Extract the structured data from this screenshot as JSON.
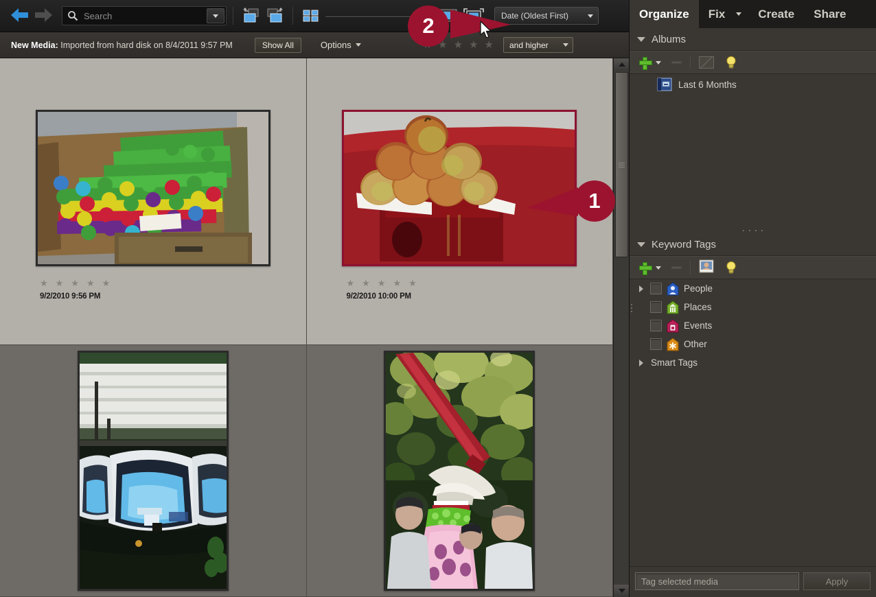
{
  "toolbar": {
    "back_icon": "back-arrow-icon",
    "forward_icon": "forward-arrow-icon",
    "search_placeholder": "Search",
    "search_value": "",
    "rotate_left_label": "Rotate Left",
    "rotate_right_label": "Rotate Right",
    "grid_view_label": "Grid View",
    "slideshow_label": "Slideshow",
    "fullscreen_label": "Full Screen",
    "sort_value": "Date (Oldest First)"
  },
  "subbar": {
    "new_media_label": "New Media:",
    "new_media_text": "Imported from hard disk on 8/4/2011 9:57 PM",
    "show_all_label": "Show All",
    "options_label": "Options",
    "rating_filter_stars": 5,
    "rating_filter_value": "and higher"
  },
  "grid": {
    "photos": [
      {
        "alt": "Colored wooden posts in a wooden crate",
        "date": "9/2/2010 9:56 PM",
        "rating": 0,
        "selected": true,
        "highlight_border": false,
        "orientation": "landscape"
      },
      {
        "alt": "Stack of apples on a red pedestal",
        "date": "9/2/2010 10:00 PM",
        "rating": 0,
        "selected": true,
        "highlight_border": true,
        "orientation": "landscape"
      },
      {
        "alt": "Blue rowboats moored at a dock",
        "date": "",
        "rating": 0,
        "selected": false,
        "highlight_border": false,
        "orientation": "portrait"
      },
      {
        "alt": "Festival performer holding a red pole",
        "date": "",
        "rating": 0,
        "selected": false,
        "highlight_border": false,
        "orientation": "portrait"
      }
    ]
  },
  "panel": {
    "tabs": [
      {
        "label": "Organize",
        "active": true
      },
      {
        "label": "Fix",
        "active": false
      },
      {
        "label": "Create",
        "active": false
      },
      {
        "label": "Share",
        "active": false
      }
    ],
    "albums": {
      "title": "Albums",
      "new_label": "New",
      "remove_label": "Remove",
      "edit_label": "Edit",
      "hint_label": "Show Hints",
      "items": [
        {
          "label": "Last 6 Months",
          "icon": "album-icon"
        }
      ]
    },
    "keyword_tags": {
      "title": "Keyword Tags",
      "new_label": "New",
      "remove_label": "Remove",
      "person_label": "People Recognition",
      "hint_label": "Show Hints",
      "items": [
        {
          "label": "People",
          "color": "#2b5fc4",
          "expandable": true,
          "checked": false
        },
        {
          "label": "Places",
          "color": "#76b02a",
          "expandable": false,
          "checked": false
        },
        {
          "label": "Events",
          "color": "#c0215a",
          "expandable": false,
          "checked": false
        },
        {
          "label": "Other",
          "color": "#d98a16",
          "expandable": false,
          "checked": false
        }
      ],
      "smart_tags_label": "Smart Tags"
    },
    "tagbar": {
      "input_placeholder": "Tag selected media",
      "input_value": "",
      "apply_label": "Apply"
    }
  },
  "callouts": [
    {
      "number": "1"
    },
    {
      "number": "2"
    }
  ],
  "colors": {
    "callout": "#9c132f",
    "accent_blue": "#4aa3e8",
    "selection_border": "#8d1230",
    "panel_bg": "#3a3733",
    "grid_bg": "#6e6a65"
  }
}
